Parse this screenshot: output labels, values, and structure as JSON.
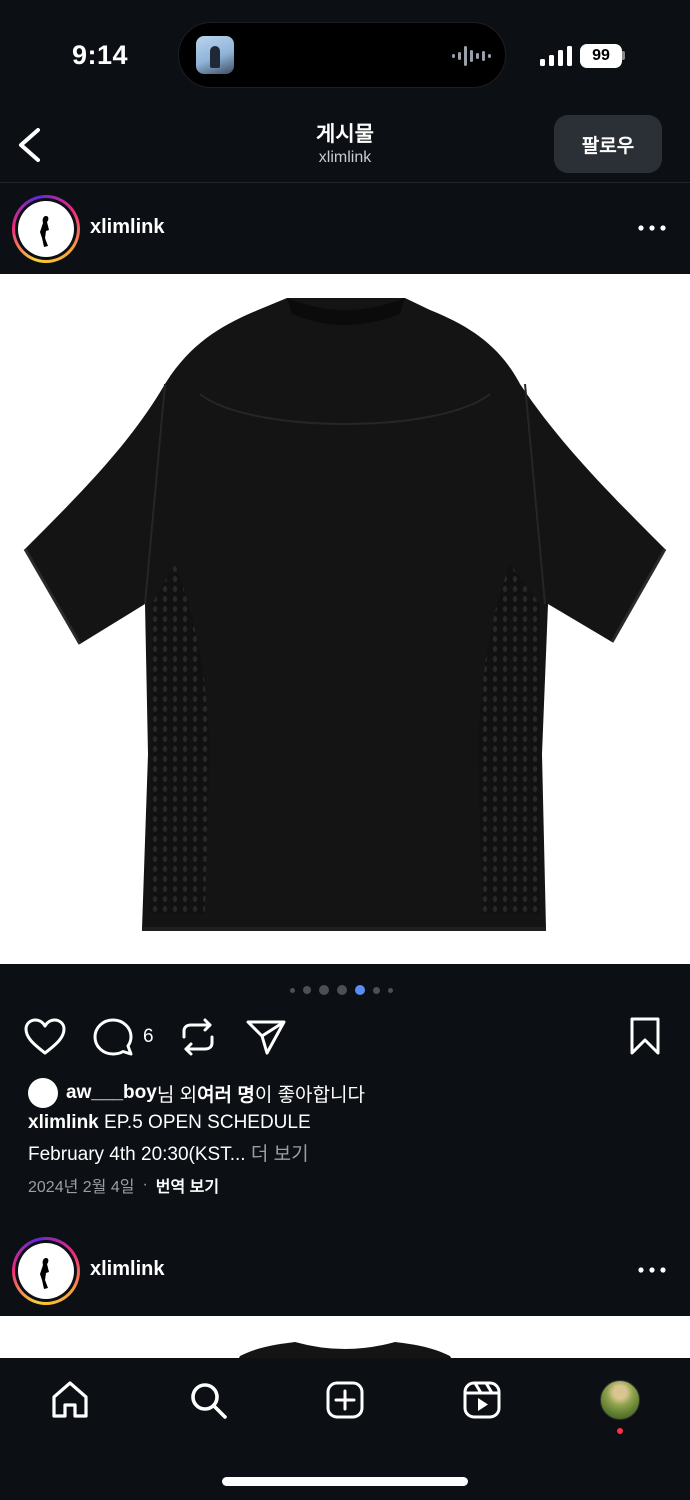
{
  "status_bar": {
    "time": "9:14",
    "battery": "99"
  },
  "header": {
    "title": "게시물",
    "subtitle": "xlimlink",
    "follow_label": "팔로우"
  },
  "post": {
    "username": "xlimlink",
    "carousel": {
      "count": 7,
      "active_index": 4
    },
    "comment_count": "6",
    "liked_by": {
      "name": "aw___boy",
      "suffix_1": "님 외 ",
      "bold": "여러 명",
      "suffix_2": "이 좋아합니다"
    },
    "caption": {
      "username": "xlimlink",
      "line1": " EP.5 OPEN SCHEDULE",
      "line2": "February 4th 20:30(KST...",
      "more": " 더 보기"
    },
    "date": "2024년 2월 4일",
    "separator": "·",
    "translate": "번역 보기"
  },
  "next_post": {
    "username": "xlimlink"
  },
  "icons": {
    "back": "chevron-left-icon",
    "more": "more-horizontal-icon",
    "like": "heart-icon",
    "comment": "comment-icon",
    "repost": "repost-icon",
    "share": "send-icon",
    "save": "bookmark-icon",
    "nav": [
      "home-icon",
      "search-icon",
      "create-icon",
      "reels-icon",
      "profile-avatar"
    ]
  },
  "colors": {
    "background": "#0c0f14",
    "active_dot": "#5b8df6",
    "notification": "#ff3040",
    "follow_button": "#2b3036"
  }
}
